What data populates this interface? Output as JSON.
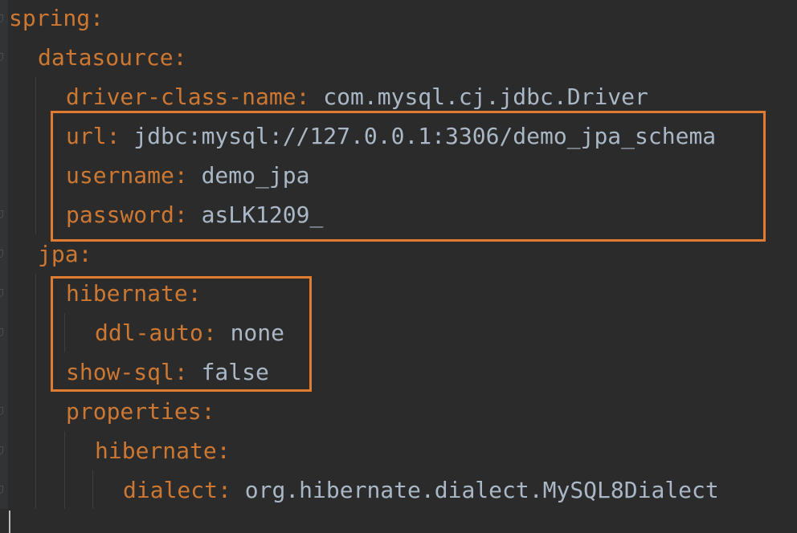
{
  "editor": {
    "lines": [
      {
        "key": "spring",
        "value": ""
      },
      {
        "key": "datasource",
        "value": ""
      },
      {
        "key": "driver-class-name",
        "value": "com.mysql.cj.jdbc.Driver"
      },
      {
        "key": "url",
        "value": "jdbc:mysql://127.0.0.1:3306/demo_jpa_schema"
      },
      {
        "key": "username",
        "value": "demo_jpa"
      },
      {
        "key": "password",
        "value": "asLK1209_"
      },
      {
        "key": "jpa",
        "value": ""
      },
      {
        "key": "hibernate",
        "value": ""
      },
      {
        "key": "ddl-auto",
        "value": "none"
      },
      {
        "key": "show-sql",
        "value": "false"
      },
      {
        "key": "properties",
        "value": ""
      },
      {
        "key": "hibernate",
        "value": ""
      },
      {
        "key": "dialect",
        "value": "org.hibernate.dialect.MySQL8Dialect"
      }
    ],
    "colors": {
      "background": "#2b2b2b",
      "key": "#cc7832",
      "value": "#a9b7c6",
      "highlight_box": "#e07b2f"
    }
  }
}
